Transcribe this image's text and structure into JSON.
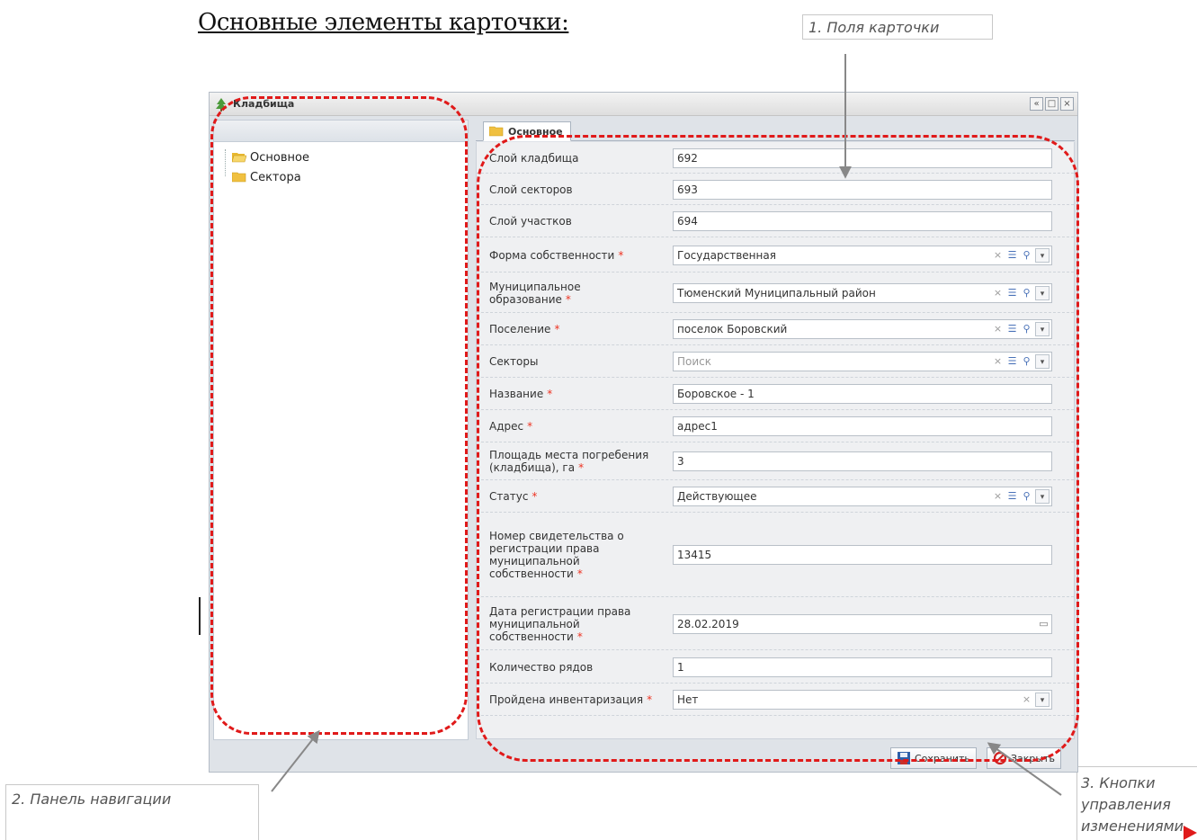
{
  "heading": "Основные элементы карточки:",
  "callouts": {
    "fields": "1. Поля карточки",
    "navigation": "2. Панель навигации",
    "buttons": "3. Кнопки управления изменениями"
  },
  "window": {
    "title": "Кладбища",
    "controls": [
      "collapse-icon",
      "maximize-icon",
      "close-icon"
    ]
  },
  "nav": {
    "items": [
      {
        "label": "Основное",
        "icon": "folder-open-icon"
      },
      {
        "label": "Сектора",
        "icon": "folder-icon"
      }
    ]
  },
  "tab": {
    "label": "Основное"
  },
  "fields": [
    {
      "label": "Слой кладбища",
      "required": false,
      "value": "692",
      "type": "text"
    },
    {
      "label": "Слой секторов",
      "required": false,
      "value": "693",
      "type": "text"
    },
    {
      "label": "Слой участков",
      "required": false,
      "value": "694",
      "type": "text"
    },
    {
      "label": "Форма собственности",
      "required": true,
      "value": "Государственная",
      "type": "select"
    },
    {
      "label": "Муниципальное образование",
      "required": true,
      "value": "Тюменский Муниципальный район",
      "type": "select"
    },
    {
      "label": "Поселение",
      "required": true,
      "value": "поселок Боровский",
      "type": "select"
    },
    {
      "label": "Секторы",
      "required": false,
      "value": "",
      "placeholder": "Поиск",
      "type": "select"
    },
    {
      "label": "Название",
      "required": true,
      "value": "Боровское - 1",
      "type": "text"
    },
    {
      "label": "Адрес",
      "required": true,
      "value": "адрес1",
      "type": "text"
    },
    {
      "label": "Площадь места погребения (кладбища), га",
      "required": true,
      "value": "3",
      "type": "text"
    },
    {
      "label": "Статус",
      "required": true,
      "value": "Действующее",
      "type": "select"
    },
    {
      "label": "Номер свидетельства о регистрации права муниципальной собственности",
      "required": true,
      "value": "13415",
      "type": "text"
    },
    {
      "label": "Дата регистрации права муниципальной собственности",
      "required": true,
      "value": "28.02.2019",
      "type": "date"
    },
    {
      "label": "Количество рядов",
      "required": false,
      "value": "1",
      "type": "text"
    },
    {
      "label": "Пройдена инвентаризация",
      "required": true,
      "value": "Нет",
      "type": "combo"
    }
  ],
  "buttons": {
    "save": "Сохранить",
    "close": "Закрыть"
  },
  "colors": {
    "highlight": "#e01a1a",
    "required": "#e32222",
    "folder": "#f0c040"
  }
}
